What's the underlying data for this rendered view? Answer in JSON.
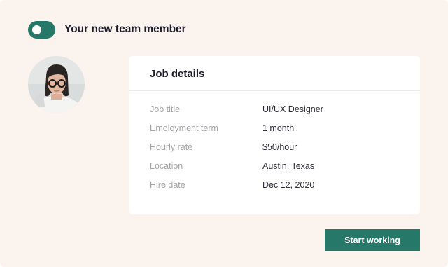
{
  "header": {
    "title": "Your new team member",
    "toggle_on": true
  },
  "profile": {
    "avatar_icon": "woman-with-glasses-avatar"
  },
  "job_details": {
    "title": "Job details",
    "rows": [
      {
        "label": "Job title",
        "value": "UI/UX Designer"
      },
      {
        "label": "Emoloyment term",
        "value": "1 month"
      },
      {
        "label": "Hourly rate",
        "value": "$50/hour"
      },
      {
        "label": "Location",
        "value": "Austin, Texas"
      },
      {
        "label": "Hire date",
        "value": "Dec 12, 2020"
      }
    ]
  },
  "actions": {
    "start_label": "Start working"
  },
  "colors": {
    "background": "#fbf3ee",
    "accent": "#267869",
    "card": "#ffffff",
    "heading": "#1f1d2b",
    "label": "#a4a2a6"
  }
}
